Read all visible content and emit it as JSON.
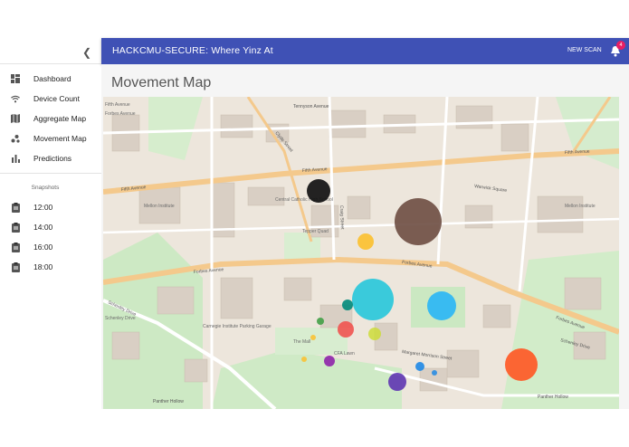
{
  "app": {
    "title": "HACKCMU-SECURE: Where Yinz At"
  },
  "header": {
    "new_scan_label": "NEW SCAN",
    "notification_count": "4"
  },
  "sidebar": {
    "collapse_icon": "chevron-left-icon",
    "items": [
      {
        "label": "Dashboard",
        "icon": "dashboard-icon"
      },
      {
        "label": "Device Count",
        "icon": "wifi-icon"
      },
      {
        "label": "Aggregate Map",
        "icon": "map-icon"
      },
      {
        "label": "Movement Map",
        "icon": "scatter-plot-icon"
      },
      {
        "label": "Predictions",
        "icon": "bar-chart-icon"
      }
    ],
    "snapshots_title": "Snapshots",
    "snapshots": [
      {
        "label": "12:00",
        "icon": "clipboard-icon"
      },
      {
        "label": "14:00",
        "icon": "clipboard-icon"
      },
      {
        "label": "16:00",
        "icon": "clipboard-icon"
      },
      {
        "label": "18:00",
        "icon": "clipboard-icon"
      }
    ]
  },
  "main": {
    "page_title": "Movement Map"
  },
  "map": {
    "street_labels": [
      "Fifth Avenue",
      "Forbes Avenue",
      "Fifth Avenue",
      "Forbes Avenue",
      "Fifth Avenue",
      "Forbes Avenue",
      "Schenley Drive",
      "Schenley Drive",
      "Margaret Morrison Street",
      "Panther Hollow",
      "Panther Hollow",
      "Tennyson Avenue",
      "Warwick Square",
      "Clyde Street",
      "Craig Street"
    ],
    "place_labels": [
      "Central Catholic High School",
      "Mellon Institute",
      "Mellon Institute",
      "Tepper Quad",
      "Carnegie Institute Parking Garage",
      "Schenley Drive",
      "Fifth Avenue",
      "Forbes Avenue",
      "The Mall",
      "CFA Lawn"
    ],
    "cluster_colors": [
      "#111111",
      "#6d4c41",
      "#fbc02d",
      "#26c6da",
      "#29b6f6",
      "#ff5722",
      "#ef5350",
      "#43a047",
      "#8e24aa",
      "#5e35b1",
      "#00897b",
      "#1e88e5",
      "#cddc39"
    ]
  }
}
